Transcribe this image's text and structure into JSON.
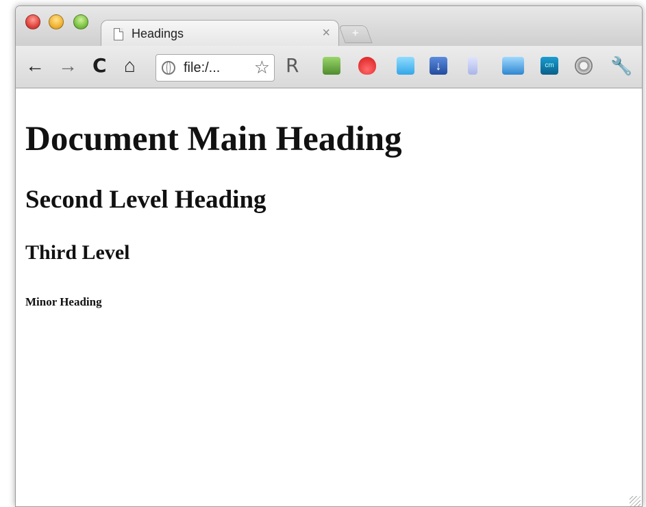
{
  "tab": {
    "title": "Headings",
    "close": "×",
    "new_tab": "+"
  },
  "toolbar": {
    "back": "←",
    "forward": "→",
    "reload": "C",
    "home": "⌂",
    "address": "file:/...",
    "bookmark": "☆",
    "ext_r": "R",
    "ext_cm": "cm",
    "extensions": [
      "evernote-icon",
      "magnet-icon",
      "twitter-icon",
      "download-icon",
      "delicious-icon",
      "screen-capture-icon",
      "cm-icon",
      "settings-gear-icon",
      "wrench-icon"
    ]
  },
  "content": {
    "h1": "Document Main Heading",
    "h2": "Second Level Heading",
    "h3": "Third Level",
    "h4": "Minor Heading"
  },
  "colors": {
    "chrome_toolbar": "#dcdcdc",
    "page_background": "#ffffff",
    "text": "#111111"
  }
}
